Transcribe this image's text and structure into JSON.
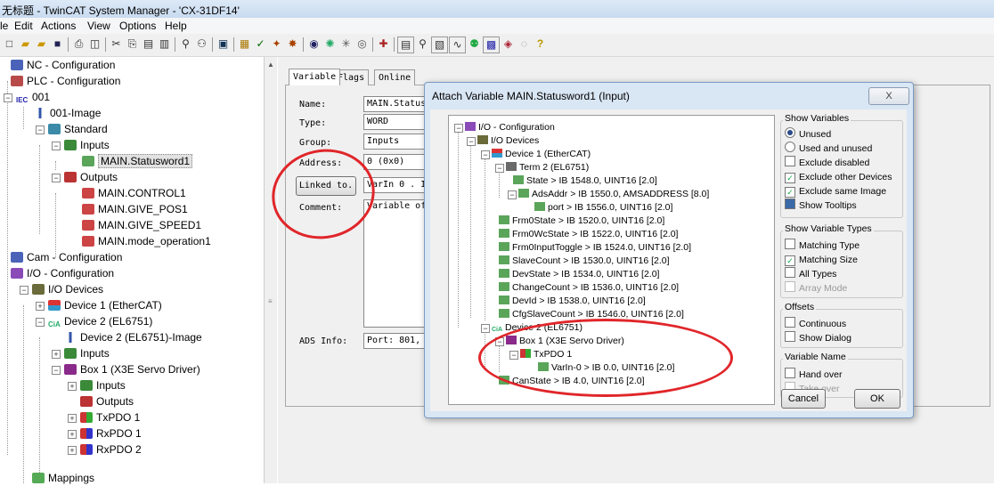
{
  "window": {
    "title": "无标题 - TwinCAT System Manager - 'CX-31DF14'"
  },
  "menu": [
    "le",
    "Edit",
    "Actions",
    "View",
    "Options",
    "Help"
  ],
  "tree": {
    "items": [
      {
        "label": "NC - Configuration"
      },
      {
        "label": "PLC - Configuration"
      },
      {
        "label": "001"
      },
      {
        "label": "001-Image"
      },
      {
        "label": "Standard"
      },
      {
        "label": "Inputs"
      },
      {
        "label": "MAIN.Statusword1"
      },
      {
        "label": "Outputs"
      },
      {
        "label": "MAIN.CONTROL1"
      },
      {
        "label": "MAIN.GIVE_POS1"
      },
      {
        "label": "MAIN.GIVE_SPEED1"
      },
      {
        "label": "MAIN.mode_operation1"
      },
      {
        "label": "Cam - Configuration"
      },
      {
        "label": "I/O - Configuration"
      },
      {
        "label": "I/O Devices"
      },
      {
        "label": "Device 1 (EtherCAT)"
      },
      {
        "label": "Device 2 (EL6751)"
      },
      {
        "label": "Device 2 (EL6751)-Image"
      },
      {
        "label": "Inputs"
      },
      {
        "label": "Box 1 (X3E Servo Driver)"
      },
      {
        "label": "Inputs"
      },
      {
        "label": "Outputs"
      },
      {
        "label": "TxPDO 1"
      },
      {
        "label": "RxPDO 1"
      },
      {
        "label": "RxPDO 2"
      },
      {
        "label": "Mappings"
      }
    ]
  },
  "variable_panel": {
    "tabs": [
      "Variable",
      "Flags",
      "Online"
    ],
    "name_label": "Name:",
    "name_value": "MAIN.Statusw",
    "type_label": "Type:",
    "type_value": "WORD",
    "group_label": "Group:",
    "group_value": "Inputs",
    "address_label": "Address:",
    "address_value": "0 (0x0)",
    "linked_button": "Linked to.",
    "linked_value": "VarIn 0 . In",
    "comment_label": "Comment:",
    "comment_value": "Variable of",
    "ads_label": "ADS Info:",
    "ads_value": "Port: 801, I"
  },
  "dialog": {
    "title": "Attach Variable MAIN.Statusword1 (Input)",
    "close": "X",
    "tree": [
      {
        "label": "I/O - Configuration"
      },
      {
        "label": "I/O Devices"
      },
      {
        "label": "Device 1 (EtherCAT)"
      },
      {
        "label": "Term 2 (EL6751)"
      },
      {
        "label": "State   >   IB 1548.0, UINT16 [2.0]"
      },
      {
        "label": "AdsAddr   >   IB 1550.0, AMSADDRESS [8.0]"
      },
      {
        "label": "port   >   IB 1556.0, UINT16 [2.0]"
      },
      {
        "label": "Frm0State   >   IB 1520.0, UINT16 [2.0]"
      },
      {
        "label": "Frm0WcState   >   IB 1522.0, UINT16 [2.0]"
      },
      {
        "label": "Frm0InputToggle   >   IB 1524.0, UINT16 [2.0]"
      },
      {
        "label": "SlaveCount   >   IB 1530.0, UINT16 [2.0]"
      },
      {
        "label": "DevState   >   IB 1534.0, UINT16 [2.0]"
      },
      {
        "label": "ChangeCount   >   IB 1536.0, UINT16 [2.0]"
      },
      {
        "label": "DevId   >   IB 1538.0, UINT16 [2.0]"
      },
      {
        "label": "CfgSlaveCount   >   IB 1546.0, UINT16 [2.0]"
      },
      {
        "label": "Device 2 (EL6751)"
      },
      {
        "label": "Box 1 (X3E Servo Driver)"
      },
      {
        "label": "TxPDO 1"
      },
      {
        "label": "VarIn-0   >   IB 0.0, UINT16 [2.0]"
      },
      {
        "label": "CanState   >   IB 4.0, UINT16 [2.0]"
      }
    ],
    "show_variables": {
      "title": "Show Variables",
      "options": [
        "Unused",
        "Used and unused",
        "Exclude disabled",
        "Exclude other Devices",
        "Exclude same Image",
        "Show Tooltips"
      ]
    },
    "show_types": {
      "title": "Show Variable Types",
      "options": [
        "Matching Type",
        "Matching Size",
        "All Types",
        "Array Mode"
      ]
    },
    "offsets": {
      "title": "Offsets",
      "options": [
        "Continuous",
        "Show Dialog"
      ]
    },
    "variable_name": {
      "title": "Variable Name",
      "options": [
        "Hand over",
        "Take over"
      ]
    },
    "cancel": "Cancel",
    "ok": "OK"
  },
  "colors": {
    "annotation": "#e0262a",
    "accent": "#2a4a8a"
  }
}
